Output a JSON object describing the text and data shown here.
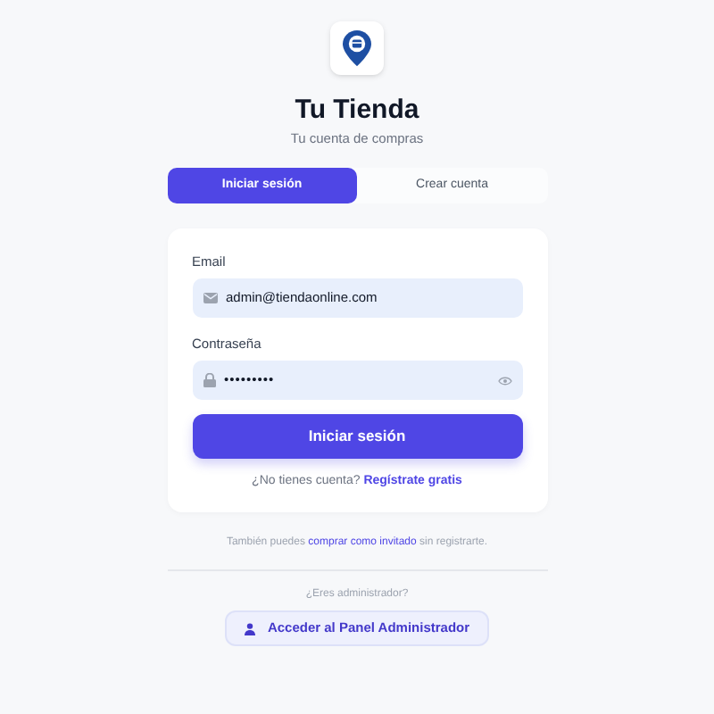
{
  "brand": {
    "title": "Tu Tienda",
    "subtitle": "Tu cuenta de compras"
  },
  "tabs": [
    {
      "label": "Iniciar sesión",
      "selected": true
    },
    {
      "label": "Crear cuenta",
      "selected": false
    }
  ],
  "form": {
    "email": {
      "label": "Email",
      "value": "admin@tiendaonline.com"
    },
    "password": {
      "label": "Contraseña",
      "value": "•••••••••"
    },
    "submit": "Iniciar sesión",
    "signup": {
      "text": "¿No tienes cuenta?",
      "link": "Regístrate gratis"
    }
  },
  "guest": {
    "before": "También puedes",
    "link": "comprar como invitado",
    "after": "sin registrarte."
  },
  "admin": {
    "question": "¿Eres administrador?",
    "button": "Acceder al Panel Administrador"
  }
}
